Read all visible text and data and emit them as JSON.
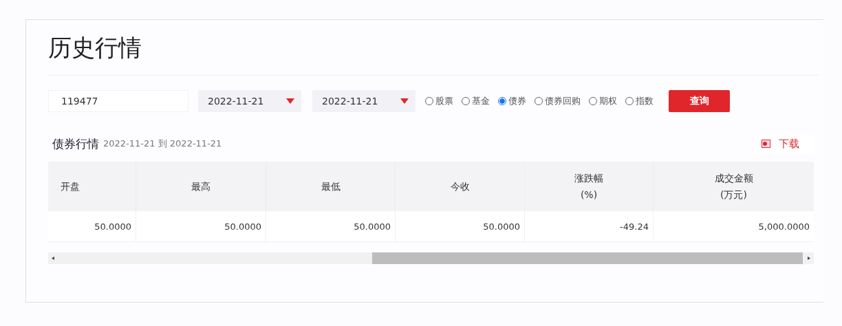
{
  "title": "历史行情",
  "filters": {
    "code": "119477",
    "start_date": "2022-11-21",
    "end_date": "2022-11-21",
    "types": [
      {
        "label": "股票",
        "selected": false
      },
      {
        "label": "基金",
        "selected": false
      },
      {
        "label": "债券",
        "selected": true
      },
      {
        "label": "债券回购",
        "selected": false
      },
      {
        "label": "期权",
        "selected": false
      },
      {
        "label": "指数",
        "selected": false
      }
    ],
    "query_button": "查询"
  },
  "section": {
    "title": "债券行情",
    "range": "2022-11-21 到 2022-11-21",
    "download": "下载"
  },
  "table": {
    "columns": [
      "开盘",
      "最高",
      "最低",
      "今收",
      "涨跌幅\n(%)",
      "成交金额\n(万元)"
    ],
    "rows": [
      [
        "50.0000",
        "50.0000",
        "50.0000",
        "50.0000",
        "-49.24",
        "5,000.0000"
      ]
    ]
  }
}
